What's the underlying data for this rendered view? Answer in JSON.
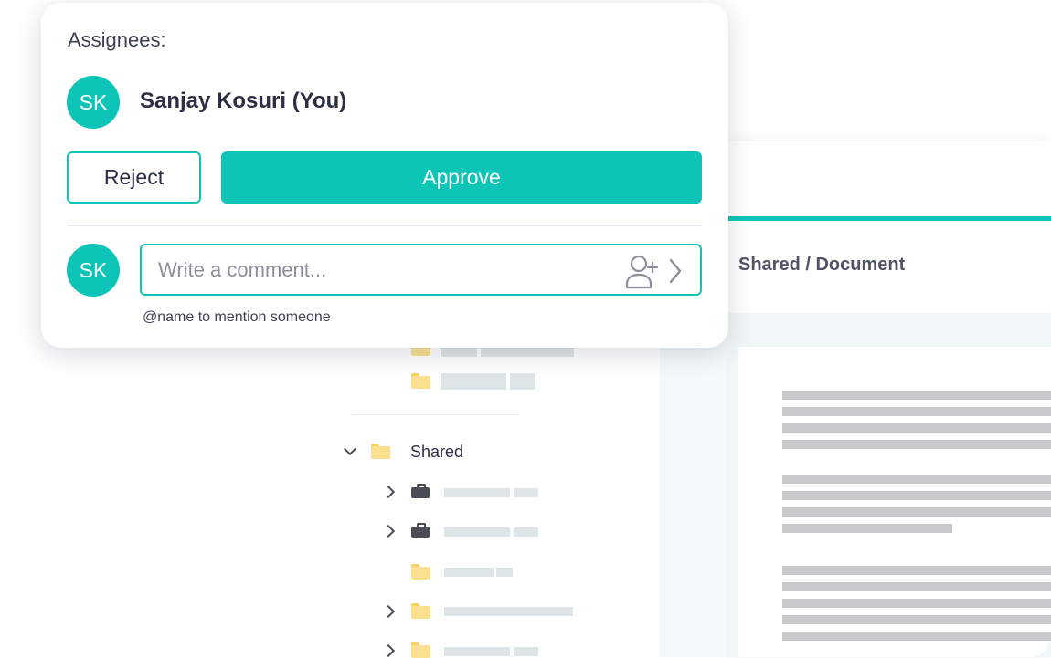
{
  "approval_card": {
    "assignees_label": "Assignees:",
    "assignee": {
      "initials": "SK",
      "name": "Sanjay Kosuri (You)"
    },
    "actions": {
      "reject_label": "Reject",
      "approve_label": "Approve"
    },
    "comment": {
      "avatar_initials": "SK",
      "placeholder": "Write a comment...",
      "value": "",
      "mention_hint": "@name to mention someone",
      "add_person_icon": "add-person-icon",
      "send_icon": "chevron-right-icon"
    }
  },
  "folder_tree": {
    "expanded_folder": {
      "label": "Shared",
      "icon": "folder-icon",
      "expand_icon": "chevron-down-icon"
    }
  },
  "document": {
    "breadcrumb": "Shared / Document"
  },
  "colors": {
    "accent": "#0cc5b7",
    "text": "#2b2f45",
    "folder": "#fbe08f",
    "placeholder_bar": "#dde5e6",
    "doc_line": "#c8c9cb"
  }
}
